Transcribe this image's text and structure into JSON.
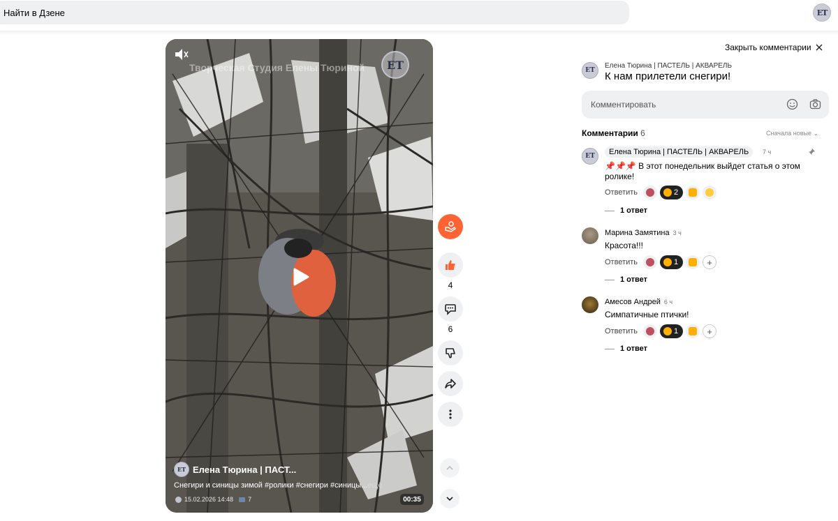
{
  "header": {
    "search_placeholder": "Найти в Дзене"
  },
  "video": {
    "watermark": "Творческая Студия Елены Тюриной",
    "author": "Елена Тюрина | ПАСТ...",
    "description": "Снегири и синицы зимой #ролики #снегири #синицы...",
    "more": "ещё",
    "date": "15.02.2026 14:48",
    "views": "7",
    "duration": "00:35"
  },
  "actions": {
    "likes": "4",
    "comments": "6"
  },
  "panel": {
    "close_label": "Закрыть комментарии",
    "post_author": "Елена Тюрина | ПАСТЕЛЬ | АКВАРЕЛЬ",
    "post_title": "К нам прилетели снегири!",
    "input_placeholder": "Комментировать",
    "comments_label": "Комментарии",
    "comments_count": "6",
    "sort_label": "Сначала новые"
  },
  "comments": [
    {
      "author": "Елена Тюрина | ПАСТЕЛЬ | АКВАРЕЛЬ",
      "time": "7 ч",
      "text_line1": "📌📌📌 В этот понедельник выйдет статья о этом",
      "text_line2": "ролике!",
      "reply_label": "Ответить",
      "like_count": "2",
      "answers": "1 ответ"
    },
    {
      "author": "Марина Замятина",
      "time": "3 ч",
      "text_line1": "Красота!!!",
      "reply_label": "Ответить",
      "like_count": "1",
      "answers": "1 ответ"
    },
    {
      "author": "Амесов Андрей",
      "time": "6 ч",
      "text_line1": "Симпатичные птички!",
      "reply_label": "Ответить",
      "like_count": "1",
      "answers": "1 ответ"
    }
  ],
  "colors": {
    "accent": "#ff6233",
    "surface": "#eff0f2"
  }
}
